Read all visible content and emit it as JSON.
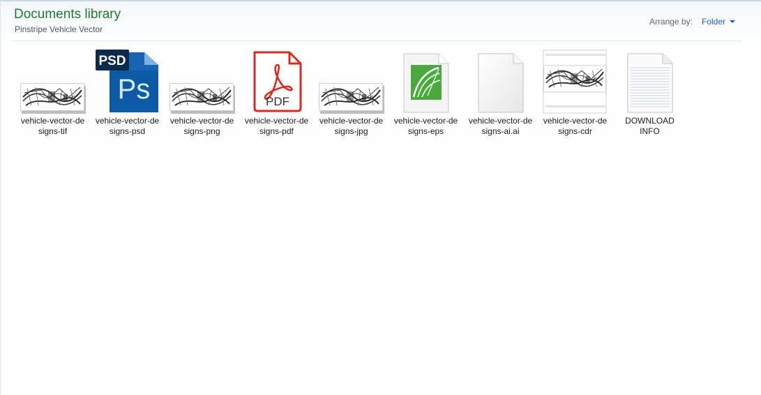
{
  "library": {
    "title": "Documents library",
    "subtitle": "Pinstripe Vehicle Vector"
  },
  "arrange": {
    "label": "Arrange by:",
    "value": "Folder"
  },
  "icons": {
    "psd_badge": "PSD",
    "ps_letters": "Ps",
    "pdf_label": "PDF"
  },
  "files": [
    {
      "line1": "vehicle-vector-de",
      "line2": "signs-tif",
      "icon": "pinstripe-thumbnail"
    },
    {
      "line1": "vehicle-vector-de",
      "line2": "signs-psd",
      "icon": "photoshop-icon"
    },
    {
      "line1": "vehicle-vector-de",
      "line2": "signs-png",
      "icon": "pinstripe-thumbnail"
    },
    {
      "line1": "vehicle-vector-de",
      "line2": "signs-pdf",
      "icon": "pdf-icon"
    },
    {
      "line1": "vehicle-vector-de",
      "line2": "signs-jpg",
      "icon": "pinstripe-thumbnail"
    },
    {
      "line1": "vehicle-vector-de",
      "line2": "signs-eps",
      "icon": "coreldraw-icon"
    },
    {
      "line1": "vehicle-vector-de",
      "line2": "signs-ai.ai",
      "icon": "blank-document-icon"
    },
    {
      "line1": "vehicle-vector-de",
      "line2": "signs-cdr",
      "icon": "pinstripe-thumbnail"
    },
    {
      "line1": "DOWNLOAD",
      "line2": "INFO",
      "icon": "text-document-icon"
    }
  ],
  "colors": {
    "title_green": "#1e7a2e",
    "link_blue": "#1e5fb4",
    "pdf_red": "#d72a20",
    "psd_blue": "#0c5aa6",
    "corel_green": "#4aa83f"
  }
}
